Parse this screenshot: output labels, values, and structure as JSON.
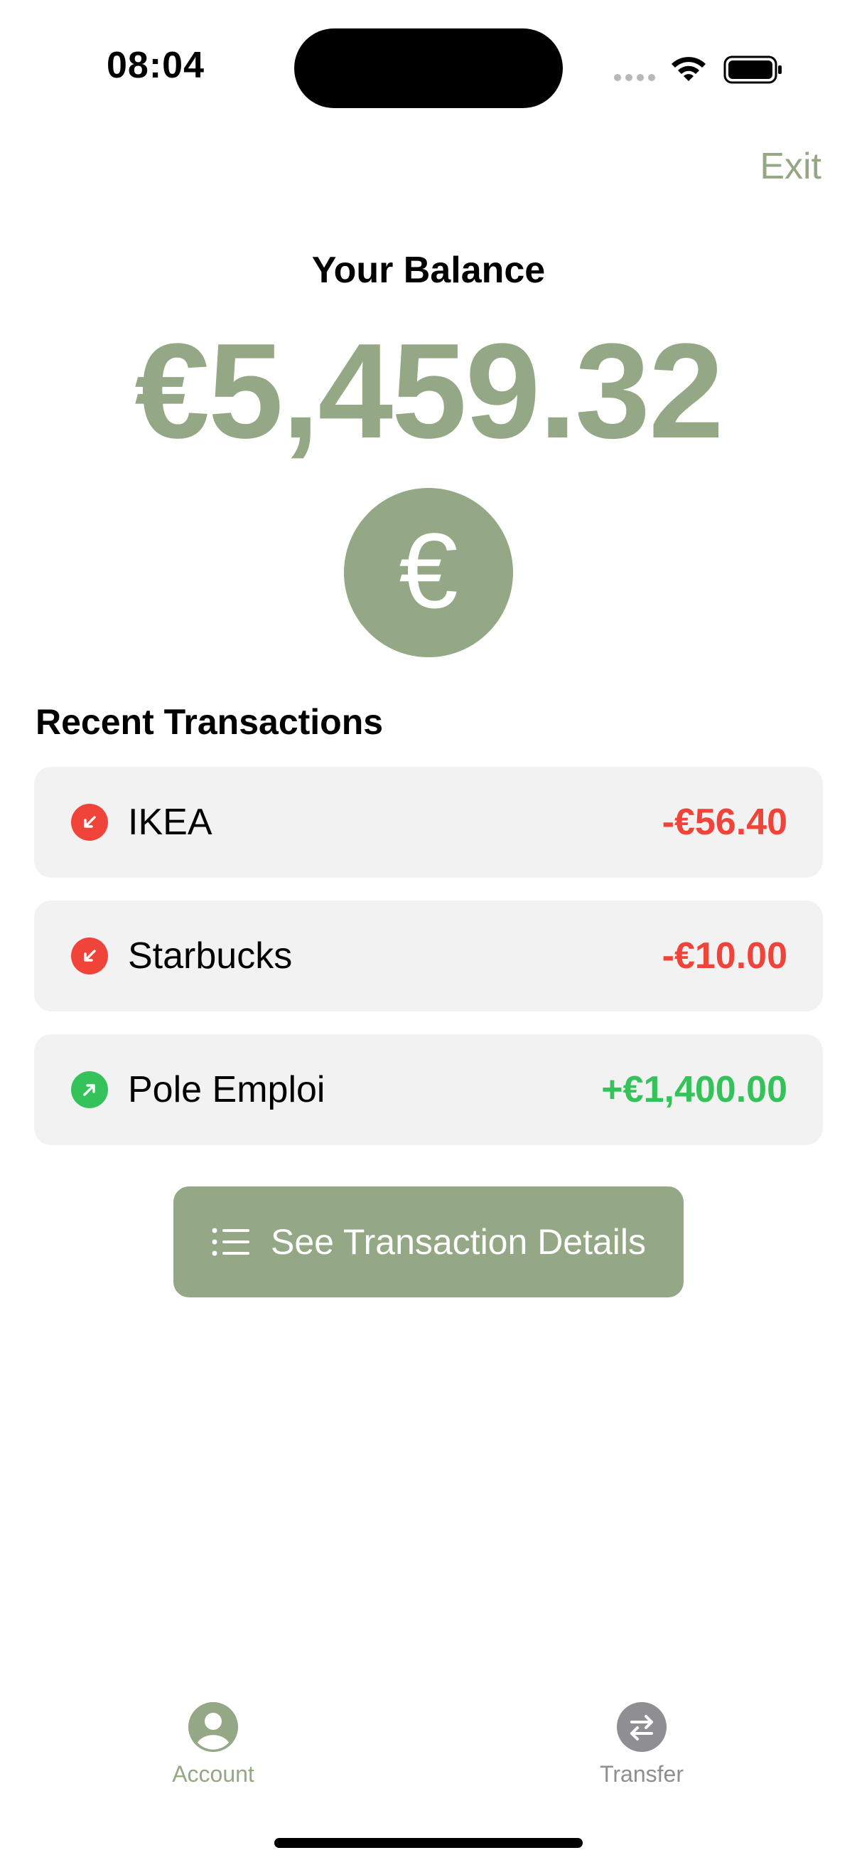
{
  "status_bar": {
    "time": "08:04"
  },
  "header": {
    "exit_label": "Exit"
  },
  "balance": {
    "title": "Your Balance",
    "amount": "€5,459.32",
    "currency_symbol": "€"
  },
  "transactions": {
    "title": "Recent Transactions",
    "items": [
      {
        "name": "IKEA",
        "amount": "-€56.40",
        "direction": "outgoing",
        "color": "#f0443a"
      },
      {
        "name": "Starbucks",
        "amount": "-€10.00",
        "direction": "outgoing",
        "color": "#f0443a"
      },
      {
        "name": "Pole Emploi",
        "amount": "+€1,400.00",
        "direction": "incoming",
        "color": "#35c25a"
      }
    ]
  },
  "details_button": {
    "label": "See Transaction Details",
    "icon": "list-icon"
  },
  "tab_bar": {
    "items": [
      {
        "label": "Account",
        "icon": "person-circle-icon",
        "active": true
      },
      {
        "label": "Transfer",
        "icon": "arrows-swap-icon",
        "active": false
      }
    ]
  },
  "colors": {
    "accent": "#94a885",
    "negative": "#f0443a",
    "positive": "#35c25a",
    "inactive": "#8e8e93",
    "card_background": "#f2f2f2"
  }
}
